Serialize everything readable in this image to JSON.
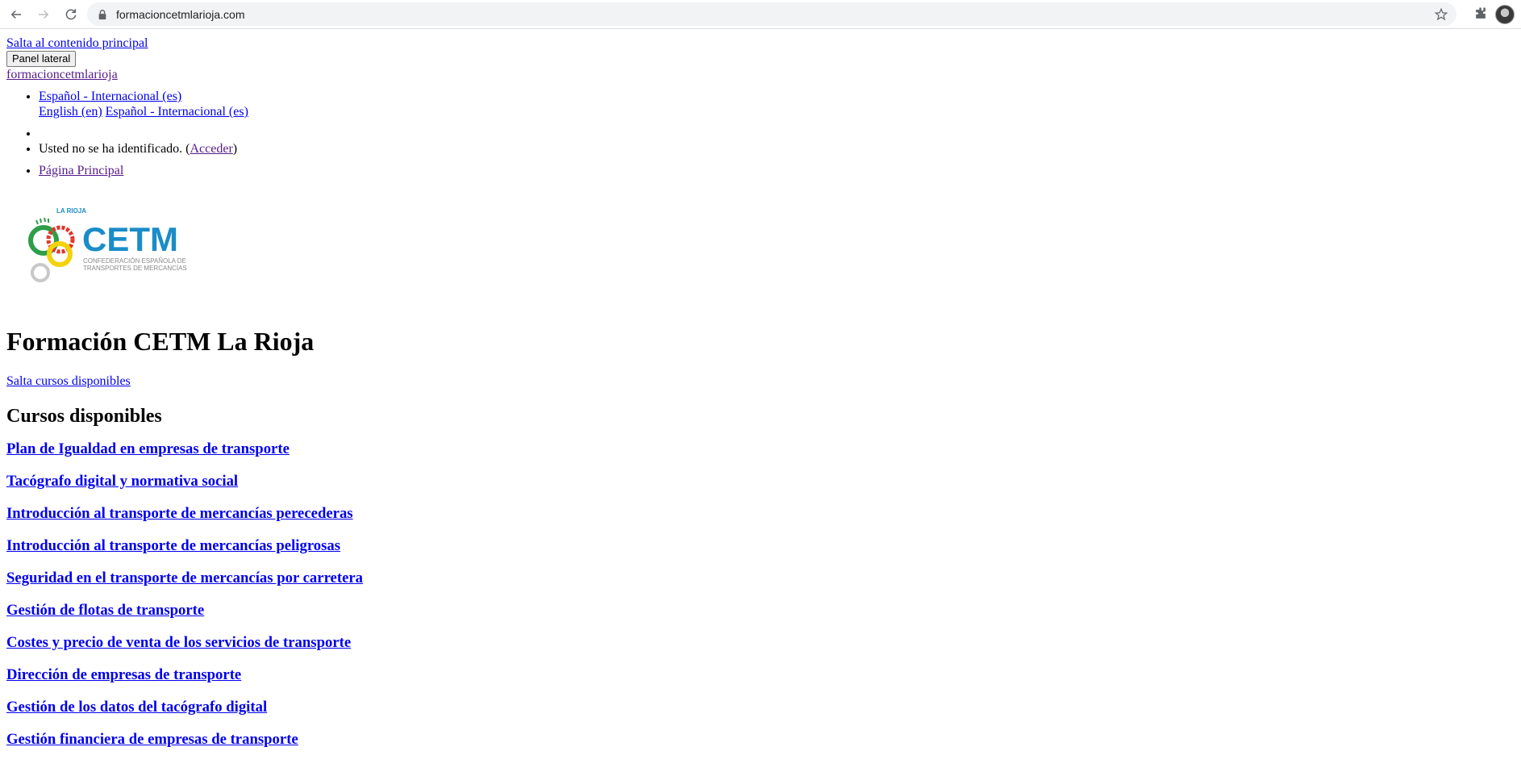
{
  "browser": {
    "url": "formacioncetmlarioja.com",
    "icons": [
      "back-arrow-icon",
      "forward-arrow-icon",
      "reload-icon",
      "lock-icon",
      "star-icon",
      "extensions-puzzle-icon"
    ]
  },
  "skip_link": "Salta al contenido principal",
  "panel_button": "Panel lateral",
  "site_name": "formacioncetmlarioja",
  "language": {
    "current": "Español - Internacional (es)",
    "options": [
      "English (en)",
      "Español - Internacional (es)"
    ]
  },
  "login": {
    "text_before": "Usted no se ha identificado. (",
    "link": "Acceder",
    "text_after": ")"
  },
  "nav": {
    "home": "Página Principal"
  },
  "logo": {
    "region": "LA RIOJA",
    "brand": "CETM",
    "line1": "CONFEDERACIÓN ESPAÑOLA DE",
    "line2": "TRANSPORTES DE MERCANCÍAS",
    "colors": {
      "blue": "#1a8cc8",
      "green": "#2e9e48",
      "red": "#e2342a",
      "yellow": "#f4d20a",
      "gray": "#8a8a8a"
    }
  },
  "page_title": "Formación CETM La Rioja",
  "skip_courses": "Salta cursos disponibles",
  "courses": {
    "heading": "Cursos disponibles",
    "items": [
      "Plan de Igualdad en empresas de transporte",
      "Tacógrafo digital y normativa social",
      "Introducción al transporte de mercancías perecederas",
      "Introducción al transporte de mercancías peligrosas",
      "Seguridad en el transporte de mercancías por carretera",
      "Gestión de flotas de transporte",
      "Costes y precio de venta de los servicios de transporte",
      "Dirección de empresas de transporte",
      "Gestión de los datos del tacógrafo digital",
      "Gestión financiera de empresas de transporte"
    ]
  }
}
